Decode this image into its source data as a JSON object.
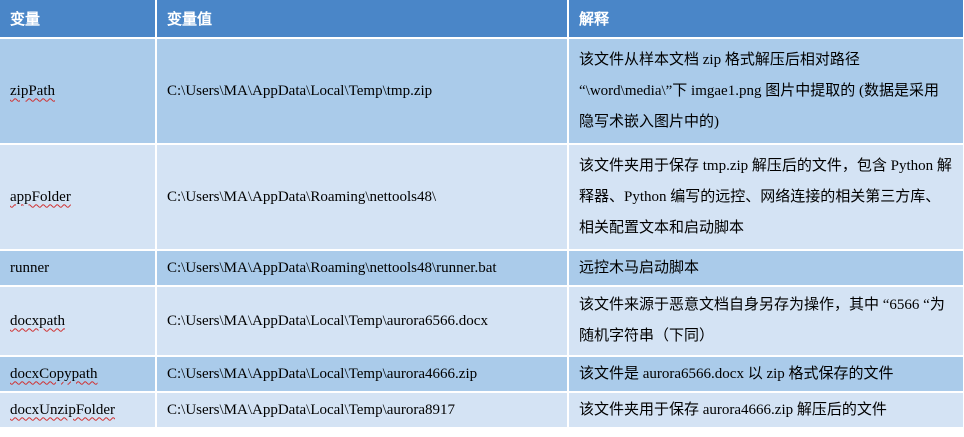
{
  "table": {
    "headers": [
      "变量",
      "变量值",
      "解释"
    ],
    "rows": [
      {
        "name": "zipPath",
        "value": "C:\\Users\\MA\\AppData\\Local\\Temp\\tmp.zip",
        "desc": "该文件从样本文档 zip 格式解压后相对路径 “\\word\\media\\”下 imgae1.png 图片中提取的 (数据是采用隐写术嵌入图片中的)"
      },
      {
        "name": "appFolder",
        "value": "C:\\Users\\MA\\AppData\\Roaming\\nettools48\\",
        "desc": "该文件夹用于保存 tmp.zip 解压后的文件，包含 Python 解释器、Python 编写的远控、网络连接的相关第三方库、相关配置文本和启动脚本"
      },
      {
        "name": "runner",
        "value": "C:\\Users\\MA\\AppData\\Roaming\\nettools48\\runner.bat",
        "desc": "远控木马启动脚本"
      },
      {
        "name": "docxpath",
        "value": "C:\\Users\\MA\\AppData\\Local\\Temp\\aurora6566.docx",
        "desc": "该文件来源于恶意文档自身另存为操作，其中 “6566 “为随机字符串（下同）"
      },
      {
        "name": "docxCopypath",
        "value": "C:\\Users\\MA\\AppData\\Local\\Temp\\aurora4666.zip",
        "desc": "该文件是 aurora6566.docx 以 zip 格式保存的文件"
      },
      {
        "name": "docxUnzipFolder",
        "value": "C:\\Users\\MA\\AppData\\Local\\Temp\\aurora8917",
        "desc": "该文件夹用于保存 aurora4666.zip 解压后的文件"
      }
    ]
  }
}
